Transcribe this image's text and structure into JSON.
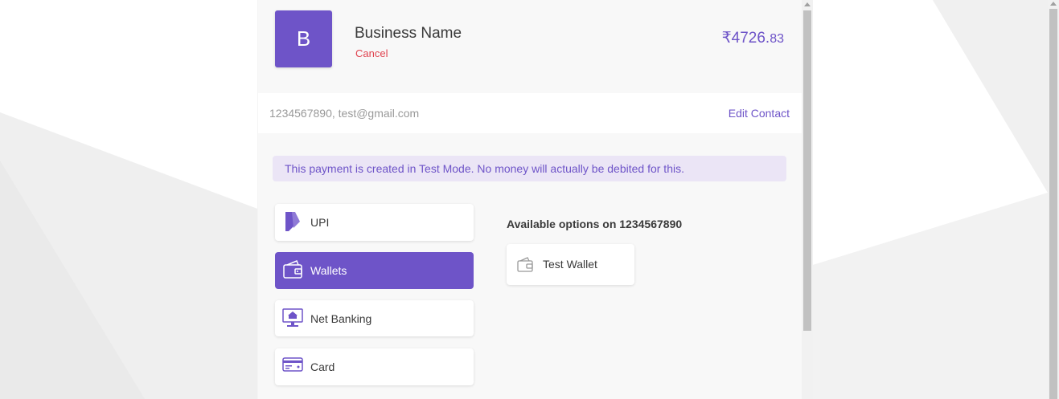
{
  "colors": {
    "brand": "#6e54c8",
    "cancel": "#e0434f",
    "notice_bg": "#ebe5f6"
  },
  "header": {
    "logo_letter": "B",
    "business_name": "Business Name",
    "cancel_label": "Cancel",
    "amount_currency": "₹",
    "amount_main": "4726.",
    "amount_paise": "83"
  },
  "contact": {
    "text": "1234567890, test@gmail.com",
    "edit_label": "Edit Contact"
  },
  "notice": "This payment is created in Test Mode. No money will actually be debited for this.",
  "methods": [
    {
      "label": "UPI",
      "icon": "upi-icon",
      "selected": false
    },
    {
      "label": "Wallets",
      "icon": "wallet-icon",
      "selected": true
    },
    {
      "label": "Net Banking",
      "icon": "bank-icon",
      "selected": false
    },
    {
      "label": "Card",
      "icon": "card-icon",
      "selected": false
    }
  ],
  "options": {
    "title": "Available options on 1234567890",
    "items": [
      {
        "label": "Test Wallet",
        "icon": "wallet-icon"
      }
    ]
  }
}
